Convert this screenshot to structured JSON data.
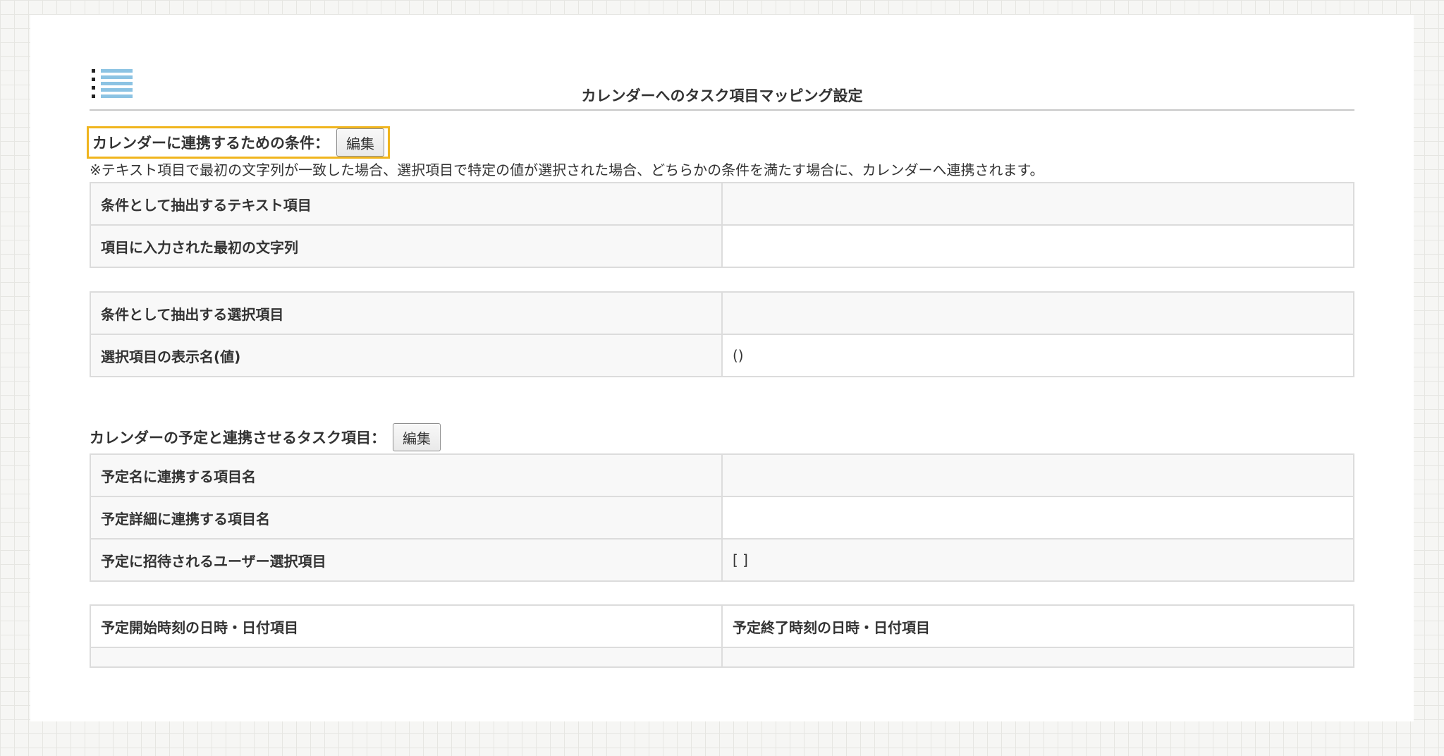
{
  "page": {
    "title": "カレンダーへのタスク項目マッピング設定"
  },
  "icons": {
    "menu": "list-icon"
  },
  "colors": {
    "highlight": "#f0b51e",
    "icon_lines": "#8cc3e3"
  },
  "conditions": {
    "heading": "カレンダーに連携するための条件：",
    "edit_label": "編集",
    "note": "※テキスト項目で最初の文字列が一致した場合、選択項目で特定の値が選択された場合、どちらかの条件を満たす場合に、カレンダーへ連携されます。",
    "text_table": [
      {
        "label": "条件として抽出するテキスト項目",
        "value": ""
      },
      {
        "label": "項目に入力された最初の文字列",
        "value": ""
      }
    ],
    "select_table": [
      {
        "label": "条件として抽出する選択項目",
        "value": ""
      },
      {
        "label": "選択項目の表示名(値)",
        "value": "()"
      }
    ]
  },
  "mapping": {
    "heading": "カレンダーの予定と連携させるタスク項目：",
    "edit_label": "編集",
    "fields": [
      {
        "label": "予定名に連携する項目名",
        "value": ""
      },
      {
        "label": "予定詳細に連携する項目名",
        "value": ""
      },
      {
        "label": "予定に招待されるユーザー選択項目",
        "value": "[ ]"
      }
    ],
    "datetime": {
      "start_header": "予定開始時刻の日時・日付項目",
      "end_header": "予定終了時刻の日時・日付項目",
      "start_value": "",
      "end_value": ""
    }
  }
}
